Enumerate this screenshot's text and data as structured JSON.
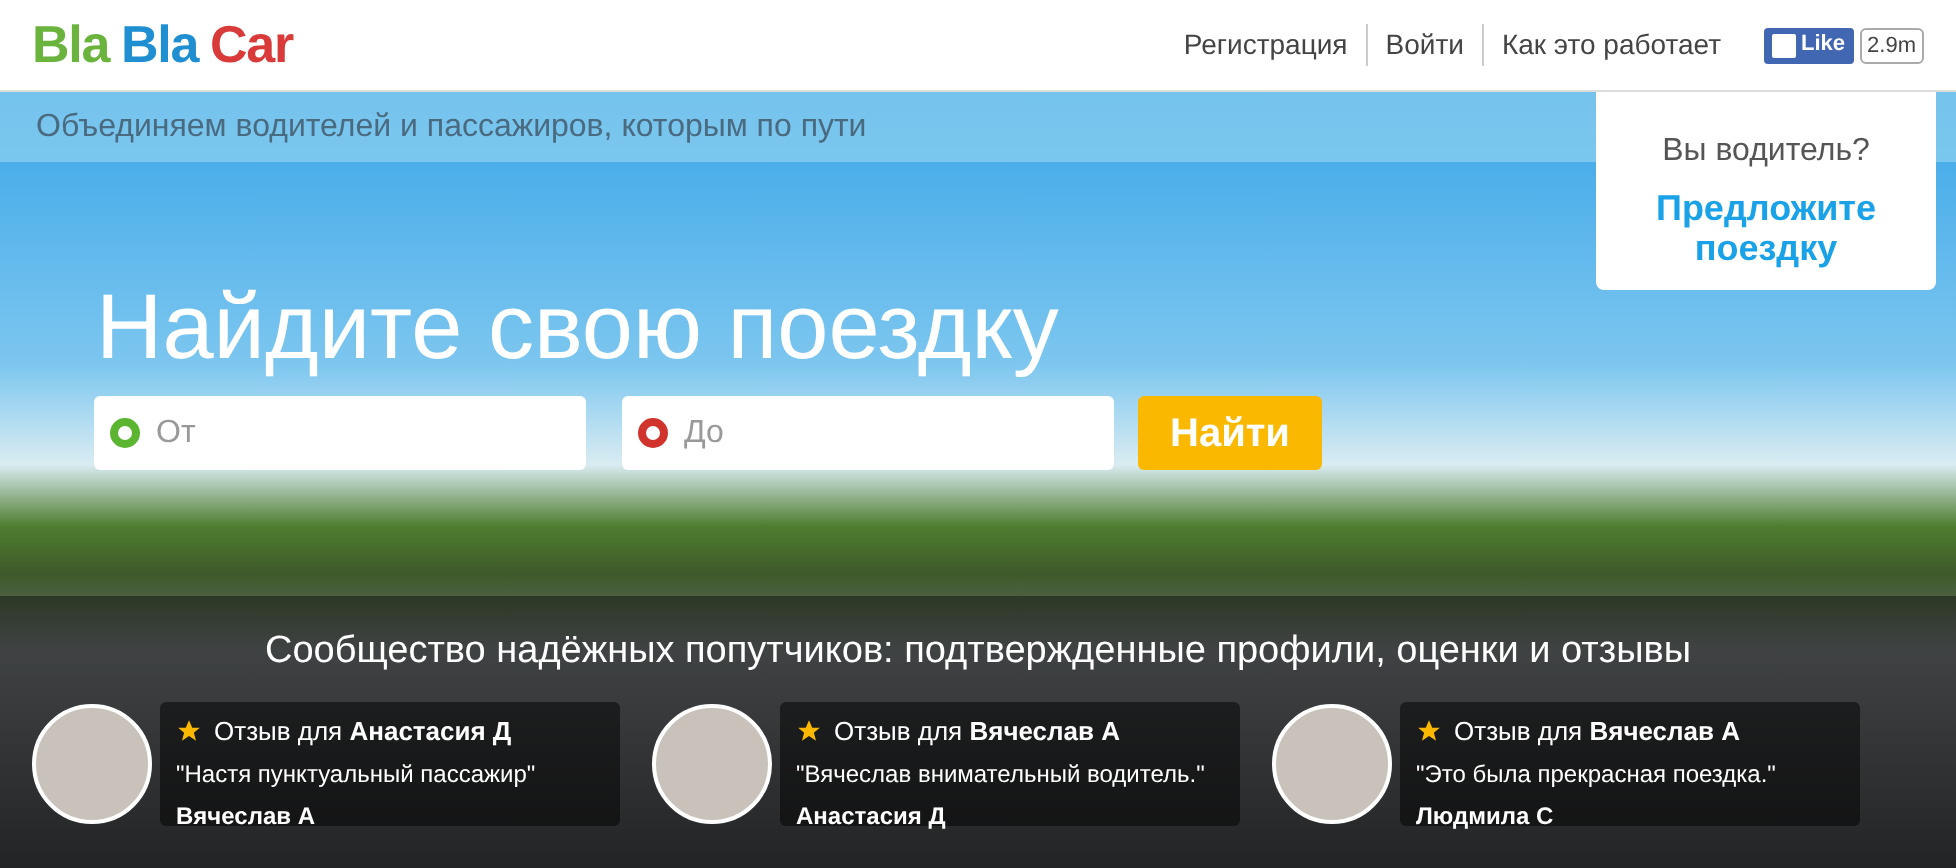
{
  "logo": [
    {
      "text": "Bla",
      "color": "#6ab43e"
    },
    {
      "text": "Bla",
      "color": "#1f8fd1"
    },
    {
      "text": "Car",
      "color": "#d93a3a"
    }
  ],
  "nav": [
    "Регистрация",
    "Войти",
    "Как это работает"
  ],
  "like": {
    "label": "Like",
    "count": "2.9m"
  },
  "tagline": "Объединяем водителей и пассажиров, которым по пути",
  "driver_card": {
    "question": "Вы водитель?",
    "link": "Предложите поездку"
  },
  "heading": "Найдите свою поездку",
  "search": {
    "from": {
      "placeholder": "От",
      "color": "#5cb531"
    },
    "to": {
      "placeholder": "До",
      "color": "#d0342c"
    },
    "button": "Найти"
  },
  "community_title": "Сообщество надёжных попутчиков: подтвержденные профили, оценки и отзывы",
  "reviews": [
    {
      "title": "Отзыв для **Анастасия Д**",
      "quote": "\"Настя пунктуальный пассажир\"",
      "author": "Вячеслав А"
    },
    {
      "title": "Отзыв для **Вячеслав А**",
      "quote": "\"Вячеслав внимательный водитель.\"",
      "author": "Анастасия Д"
    },
    {
      "title": "Отзыв для **Вячеслав А**",
      "quote": "\"Это была прекрасная поездка.\"",
      "author": "Людмила С"
    }
  ]
}
